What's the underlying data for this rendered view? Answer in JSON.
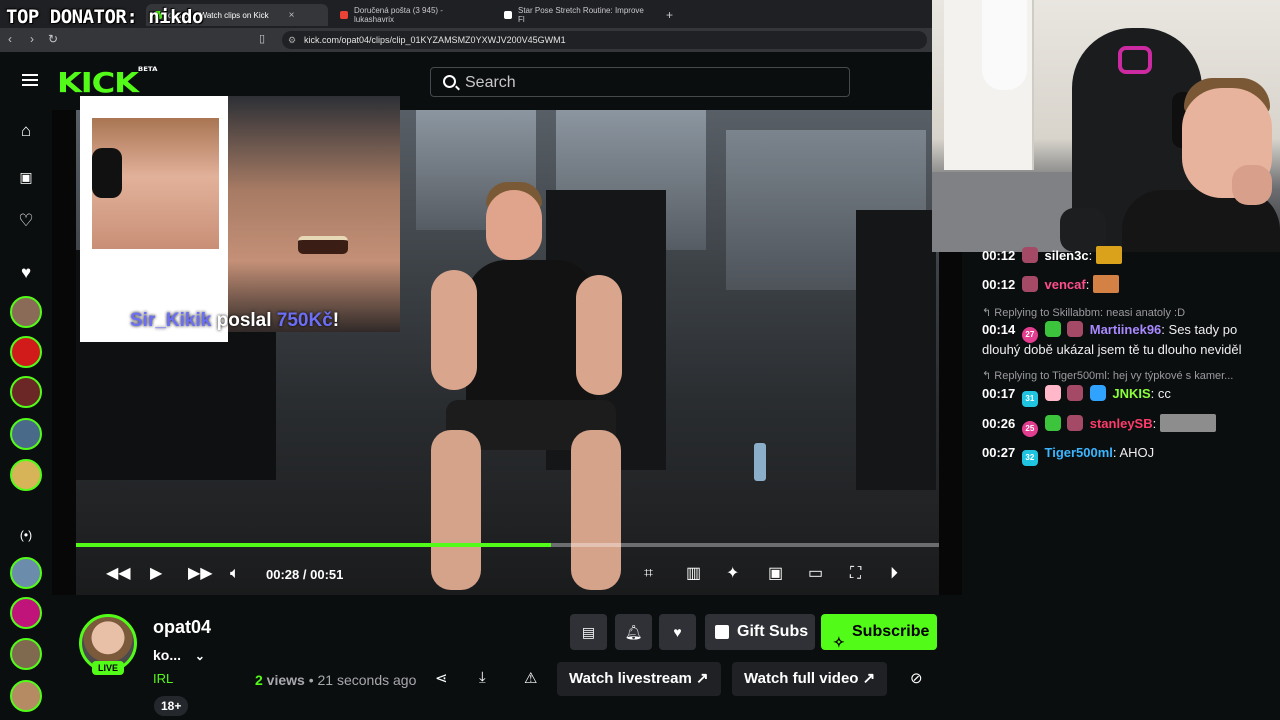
{
  "browser": {
    "tabs": [
      {
        "title": "opat04 - Watch clips on Kick",
        "color": "#53fc18"
      },
      {
        "title": "Doručená pošta (3 945) - lukashavrix",
        "color": "#ea4335"
      },
      {
        "title": "Star Pose Stretch Routine: Improve Fl",
        "color": "#ffffff"
      }
    ],
    "tab_close": "×",
    "new_tab": "+",
    "url": "kick.com/opat04/clips/clip_01KYZAMSMZ0YXWJV200V45GWM1"
  },
  "overlay": {
    "top_donator": "TOP DONATOR: nikdo",
    "donor_name": "Sir_Kikik",
    "donation_text": " poslal ",
    "amount": "750Kč",
    "exclamation": "!"
  },
  "header": {
    "logo": "KICK",
    "logo_tag": "BETA",
    "search_placeholder": "Search"
  },
  "player": {
    "progress": 0.55,
    "current_time": "00:28",
    "separator": "/",
    "duration": "00:51",
    "accent": "#53fc18"
  },
  "chat": {
    "messages": [
      {
        "time": "00:12",
        "user": "silen3c",
        "user_color": "#ffffff",
        "text": ""
      },
      {
        "time": "00:12",
        "user": "vencaf",
        "user_color": "#ff4f8b",
        "text": ""
      },
      {
        "reply": "Replying to Skillabbm: neasi anatoly :D",
        "time": "00:14",
        "sub_months": "27",
        "user": "Martiinek96",
        "user_color": "#a889ff",
        "text": "Ses tady po",
        "text2": "dlouhý době ukázal jsem tě tu dlouho neviděl"
      },
      {
        "reply": "Replying to Tiger500ml: hej vy týpkové s kamer...",
        "time": "00:17",
        "sub_months": "31",
        "user": "JNKIS",
        "user_color": "#8aff3b",
        "text": "cc"
      },
      {
        "time": "00:26",
        "sub_months": "25",
        "user": "stanleySB",
        "user_color": "#ff3b6b",
        "text": ""
      },
      {
        "time": "00:27",
        "sub_months": "32",
        "user": "Tiger500ml",
        "user_color": "#3bb6ff",
        "text": "AHOJ"
      }
    ]
  },
  "channel": {
    "name": "opat04",
    "live_badge": "LIVE",
    "subtitle": "ko...",
    "category": "IRL",
    "age_badge": "18+",
    "views_count": "2",
    "views_label": " views",
    "time_ago": " • 21 seconds ago",
    "gift_subs": "Gift Subs",
    "subscribe": "Subscribe",
    "watch_livestream": "Watch livestream",
    "watch_full_video": "Watch full video"
  }
}
